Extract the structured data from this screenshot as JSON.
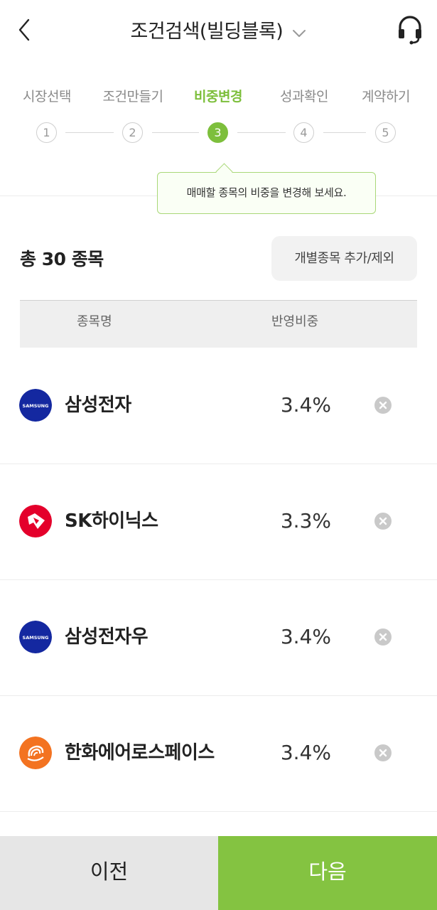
{
  "header": {
    "title": "조건검색(빌딩블록)",
    "back_icon": "chevron-left-icon",
    "help_icon": "headset-icon"
  },
  "steps": [
    {
      "label": "시장선택",
      "number": "1",
      "active": false
    },
    {
      "label": "조건만들기",
      "number": "2",
      "active": false
    },
    {
      "label": "비중변경",
      "number": "3",
      "active": true
    },
    {
      "label": "성과확인",
      "number": "4",
      "active": false
    },
    {
      "label": "계약하기",
      "number": "5",
      "active": false
    }
  ],
  "tooltip": "매매할 종목의 비중을 변경해 보세요.",
  "summary": {
    "total_label": "총 30 종목",
    "add_button": "개별종목 추가/제외"
  },
  "table": {
    "col_name": "종목명",
    "col_weight": "반영비중",
    "rows": [
      {
        "name": "삼성전자",
        "weight": "3.4%",
        "logo": "samsung-logo",
        "logo_text": "SAMSUNG"
      },
      {
        "name": "SK하이닉스",
        "weight": "3.3%",
        "logo": "sk-hynix-logo"
      },
      {
        "name": "삼성전자우",
        "weight": "3.4%",
        "logo": "samsung-logo",
        "logo_text": "SAMSUNG"
      },
      {
        "name": "한화에어로스페이스",
        "weight": "3.4%",
        "logo": "hanwha-logo"
      }
    ]
  },
  "buttons": {
    "prev": "이전",
    "next": "다음"
  },
  "colors": {
    "accent": "#7dbf3c",
    "next_button": "#84c341",
    "samsung": "#1428a0",
    "sk": "#e4002b",
    "hanwha": "#f37321"
  }
}
